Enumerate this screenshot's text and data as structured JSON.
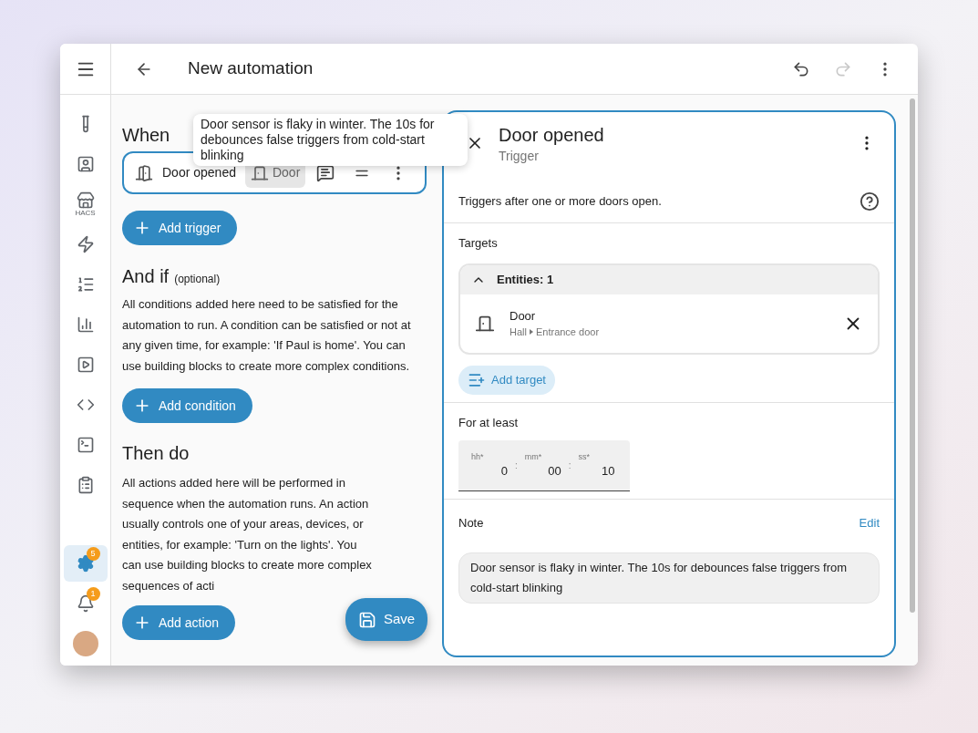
{
  "header": {
    "title": "New automation",
    "undo_disabled": false,
    "redo_disabled": true
  },
  "sidebar": {
    "items": [
      {
        "selected": false
      },
      {
        "selected": false
      },
      {
        "selected": false,
        "label": "HACS"
      },
      {
        "selected": false
      },
      {
        "selected": false
      },
      {
        "selected": false
      },
      {
        "selected": false
      },
      {
        "selected": false
      },
      {
        "selected": false
      },
      {
        "selected": false
      },
      {
        "selected": true,
        "badge": "5"
      },
      {
        "selected": false,
        "badge": "1"
      }
    ]
  },
  "when": {
    "heading": "When",
    "triggers": [
      {
        "label": "Door opened",
        "target": "Door",
        "selected": true
      }
    ],
    "add_button": "Add trigger"
  },
  "and_if": {
    "heading": "And if",
    "hint": "(optional)",
    "description": "All conditions added here need to be satisfied for the automation to run. A condition can be satisfied or not at any given time, for example: 'If Paul is home'. You can use building blocks to create more complex conditions.",
    "add_button": "Add condition"
  },
  "then_do": {
    "heading": "Then do",
    "description": "All actions added here will be performed in sequence when the automation runs. An action usually controls one of your areas, devices, or entities, for example: 'Turn on the lights'. You can use building blocks to create more complex sequences of acti",
    "add_button": "Add action"
  },
  "tooltip": "Door sensor is flaky in winter. The 10s for debounces false triggers from cold-start blinking",
  "save_button": "Save",
  "panel": {
    "title": "Door opened",
    "subtitle": "Trigger",
    "description": "Triggers after one or more doors open.",
    "targets": {
      "label": "Targets",
      "group": {
        "title": "Entities: 1",
        "expanded": true,
        "entities": [
          {
            "name": "Door",
            "path": [
              "Hall",
              "Entrance door"
            ]
          }
        ]
      },
      "add_button": "Add target"
    },
    "duration": {
      "label": "For at least",
      "separator": ":",
      "fields": [
        {
          "label": "hh*",
          "value": "0"
        },
        {
          "label": "mm*",
          "value": "00"
        },
        {
          "label": "ss*",
          "value": "10"
        }
      ]
    },
    "note": {
      "label": "Note",
      "edit": "Edit",
      "text": "Door sensor is flaky in winter. The 10s for debounces false triggers from cold-start blinking"
    }
  }
}
